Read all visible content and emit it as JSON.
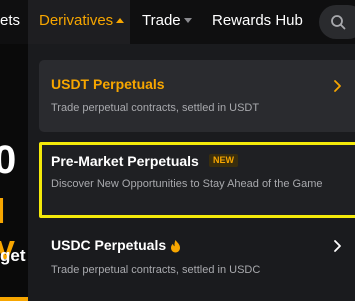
{
  "nav": {
    "partial_label": "ets",
    "derivatives_label": "Derivatives",
    "trade_label": "Trade",
    "rewards_label": "Rewards Hub"
  },
  "background": {
    "big_text": "0",
    "yellow_text": "l v",
    "small_text": "get"
  },
  "menu": {
    "usdt": {
      "title": "USDT Perpetuals",
      "description": "Trade perpetual contracts, settled in USDT"
    },
    "premarket": {
      "title": "Pre-Market Perpetuals",
      "badge": "NEW",
      "description": "Discover New Opportunities to Stay Ahead of the Game"
    },
    "usdc": {
      "title": "USDC Perpetuals",
      "description": "Trade perpetual contracts, settled in USDC"
    }
  },
  "colors": {
    "accent": "#f7a600",
    "highlight_border": "#f4ea0a",
    "dropdown_bg": "#1a1b1e"
  },
  "icons": [
    "caret-up-icon",
    "caret-down-icon",
    "search-icon",
    "chevron-right-icon",
    "flame-icon"
  ]
}
